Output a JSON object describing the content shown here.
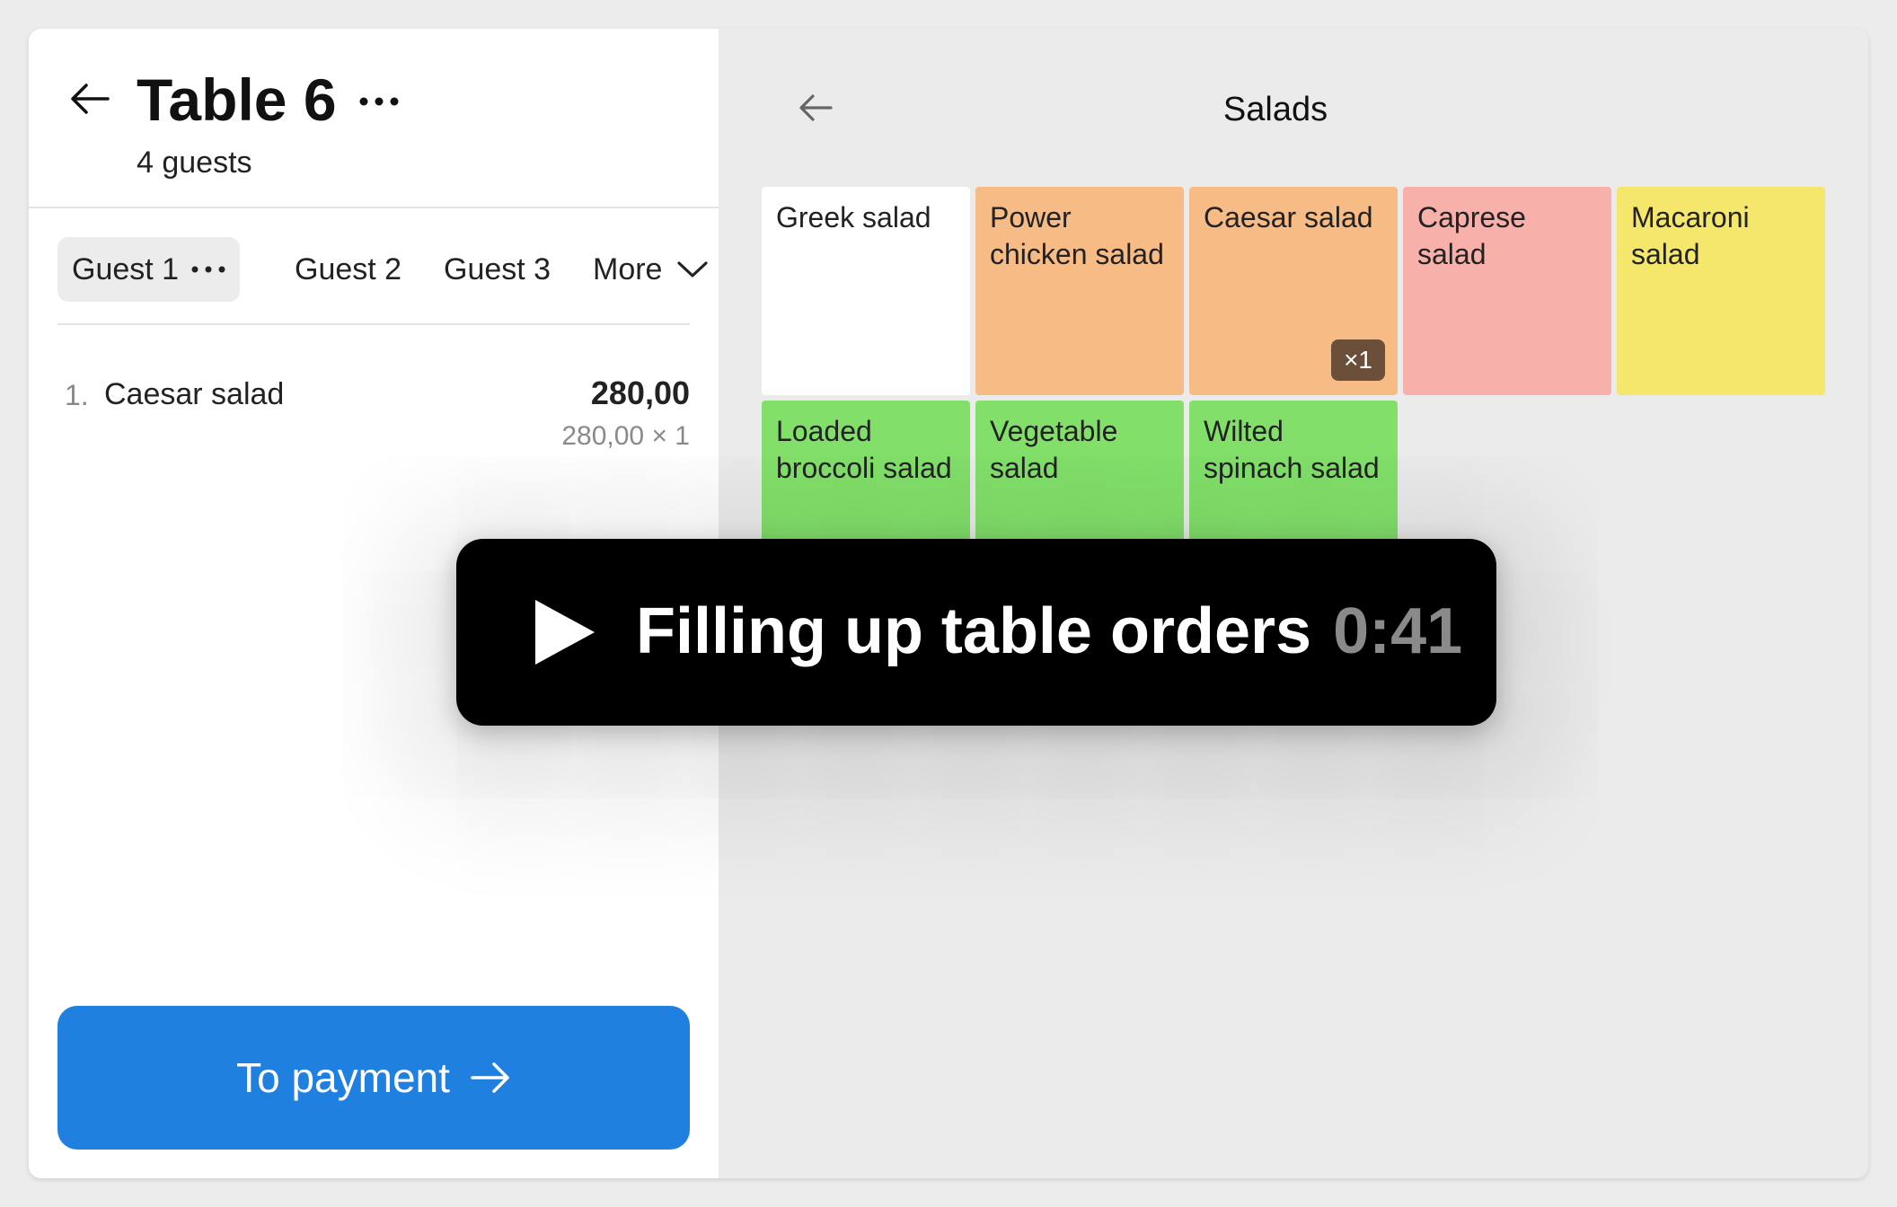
{
  "order_panel": {
    "title": "Table 6",
    "guests_count": "4 guests",
    "tabs": [
      {
        "label": "Guest 1",
        "active": true
      },
      {
        "label": "Guest 2",
        "active": false
      },
      {
        "label": "Guest 3",
        "active": false
      },
      {
        "label": "More",
        "active": false
      }
    ],
    "items": [
      {
        "number": "1.",
        "name": "Caesar salad",
        "total": "280,00",
        "detail": "280,00 × 1"
      }
    ],
    "pay_button_label": "To payment"
  },
  "menu_panel": {
    "category_title": "Salads",
    "products": [
      {
        "name": "Greek salad",
        "color": "#ffffff",
        "quantity": ""
      },
      {
        "name": "Power chicken salad",
        "color": "#f7bc86",
        "quantity": ""
      },
      {
        "name": "Caesar salad",
        "color": "#f7bc86",
        "quantity": "×1"
      },
      {
        "name": "Caprese salad",
        "color": "#f8b0ab",
        "quantity": ""
      },
      {
        "name": "Macaroni salad",
        "color": "#f5e76c",
        "quantity": ""
      },
      {
        "name": "Loaded broccoli salad",
        "color": "#82e06a",
        "quantity": ""
      },
      {
        "name": "Vegetable salad",
        "color": "#82e06a",
        "quantity": ""
      },
      {
        "name": "Wilted spinach salad",
        "color": "#82e06a",
        "quantity": ""
      }
    ]
  },
  "video_overlay": {
    "title": "Filling up table orders",
    "duration": "0:41"
  },
  "colors": {
    "accent": "#1f80e0",
    "badge": "#6b4f3b"
  },
  "icons": {
    "back": "arrow-left-icon",
    "more": "more-horizontal-icon",
    "chevron": "chevron-down-icon",
    "pay_arrow": "arrow-right-icon",
    "play": "play-icon"
  }
}
